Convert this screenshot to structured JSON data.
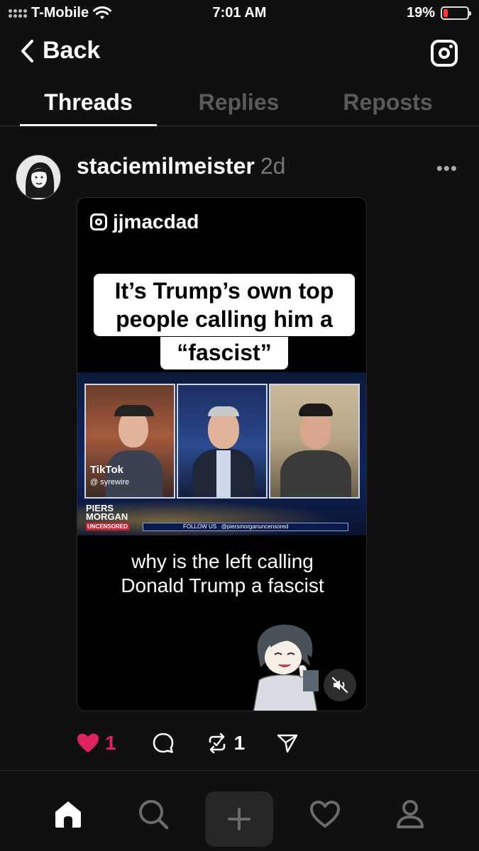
{
  "status_bar": {
    "carrier": "T-Mobile",
    "time": "7:01 AM",
    "battery": "19%",
    "battery_level": 0.19
  },
  "header": {
    "back_label": "Back",
    "instagram_icon": "instagram-icon"
  },
  "tabs": [
    {
      "label": "Threads",
      "active": true
    },
    {
      "label": "Replies",
      "active": false
    },
    {
      "label": "Reposts",
      "active": false
    }
  ],
  "post": {
    "username": "staciemilmeister",
    "age": "2d",
    "more_icon": "ellipsis-icon",
    "media": {
      "handle": "jjmacdad",
      "caption_lines": [
        "It’s Trump’s own top",
        "people calling him a",
        "“fascist”"
      ],
      "tiktok_label": "TikTok",
      "tiktok_user": "@ syrewire",
      "logo_lines": [
        "PIERS",
        "MORGAN",
        "UNCENSORED"
      ],
      "follow_bar": "FOLLOW US",
      "follow_handle": "@piersmorganuncensored",
      "subtitle_lines": [
        "why is the left calling",
        "Donald Trump a fascist"
      ],
      "mute_icon": "muted-speaker-icon"
    },
    "actions": {
      "likes": "1",
      "reposts": "1",
      "like_color": "#e0245e"
    }
  },
  "bottom_nav": [
    "home-icon",
    "search-icon",
    "plus-icon",
    "heart-icon",
    "profile-icon"
  ]
}
